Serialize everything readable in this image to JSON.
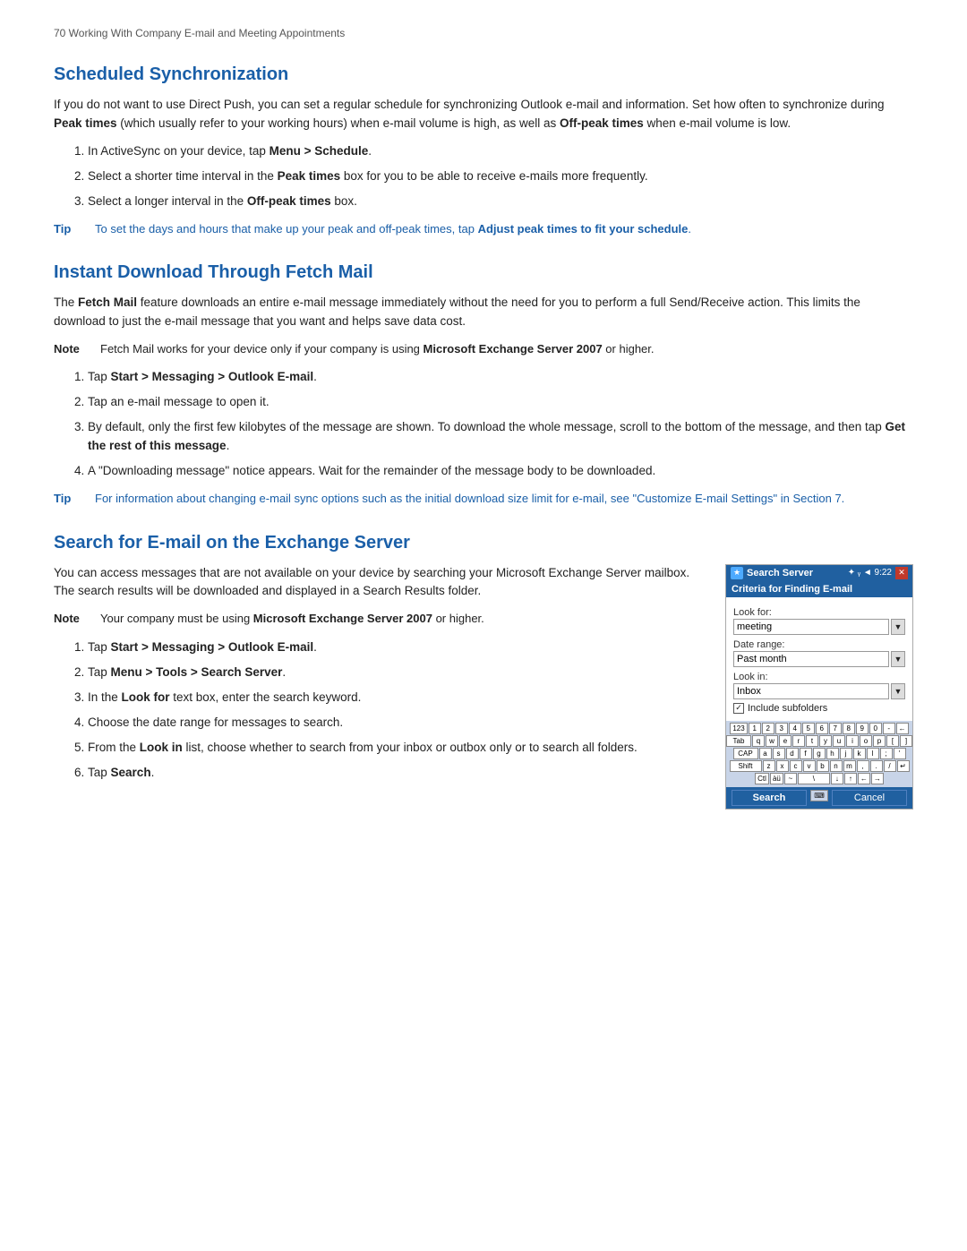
{
  "page": {
    "header": "70  Working With Company E-mail and Meeting Appointments",
    "sections": [
      {
        "id": "scheduled-sync",
        "title": "Scheduled Synchronization",
        "intro": "If you do not want to use Direct Push, you can set a regular schedule for synchronizing Outlook e-mail and information. Set how often to synchronize during ",
        "intro_bold1": "Peak times",
        "intro_mid1": " (which usually refer to your working hours) when e-mail volume is high, as well as ",
        "intro_bold2": "Off-peak times",
        "intro_mid2": " when e-mail volume is low.",
        "steps": [
          {
            "num": 1,
            "text": "In ActiveSync on your device, tap ",
            "bold": "Menu > Schedule",
            "end": "."
          },
          {
            "num": 2,
            "text": "Select a shorter time interval in the ",
            "bold": "Peak times",
            "end": " box for you to be able to receive e-mails more frequently."
          },
          {
            "num": 3,
            "text": "Select a longer interval in the ",
            "bold": "Off-peak times",
            "end": " box."
          }
        ],
        "tip": {
          "label": "Tip",
          "text": "To set the days and hours that make up your peak and off-peak times, tap ",
          "bold": "Adjust peak times to fit your schedule",
          "end": "."
        }
      },
      {
        "id": "fetch-mail",
        "title": "Instant Download Through Fetch Mail",
        "intro": "The ",
        "intro_bold": "Fetch Mail",
        "intro_rest": " feature downloads an entire e-mail message immediately without the need for you to perform a full Send/Receive action. This limits the download to just the e-mail message that you want and helps save data cost.",
        "note": {
          "label": "Note",
          "text": "Fetch Mail works for your device only if your company is using ",
          "bold": "Microsoft Exchange Server 2007",
          "end": " or higher."
        },
        "steps": [
          {
            "num": 1,
            "text": "Tap ",
            "bold": "Start > Messaging > Outlook E-mail",
            "end": "."
          },
          {
            "num": 2,
            "text": "Tap an e-mail message to open it.",
            "bold": "",
            "end": ""
          },
          {
            "num": 3,
            "text": "By default, only the first few kilobytes of the message are shown. To download the whole message, scroll to the bottom of the message, and then tap ",
            "bold": "Get the rest of this message",
            "end": "."
          },
          {
            "num": 4,
            "text": "A \"Downloading message\" notice appears. Wait for the remainder of the message body to be downloaded.",
            "bold": "",
            "end": ""
          }
        ],
        "tip": {
          "label": "Tip",
          "text": "For information about changing e-mail sync options such as the initial download size limit for e-mail, see \"Customize E-mail Settings\" in Section 7."
        }
      },
      {
        "id": "search-email",
        "title": "Search for E-mail on the Exchange Server",
        "intro": "You can access messages that are not available on your device by searching your Microsoft Exchange Server mailbox. The search results will be downloaded and displayed in a Search Results folder.",
        "note": {
          "label": "Note",
          "text": "Your company must be using ",
          "bold": "Microsoft Exchange Server 2007",
          "end": " or higher."
        },
        "steps": [
          {
            "num": 1,
            "text": "Tap ",
            "bold": "Start > Messaging > Outlook E-mail",
            "end": "."
          },
          {
            "num": 2,
            "text": "Tap ",
            "bold": "Menu > Tools > Search Server",
            "end": "."
          },
          {
            "num": 3,
            "text": "In the ",
            "bold": "Look for",
            "end": " text box, enter the search keyword."
          },
          {
            "num": 4,
            "text": "Choose the date range for messages to search.",
            "bold": "",
            "end": ""
          },
          {
            "num": 5,
            "text": "From the ",
            "bold": "Look in",
            "end": " list, choose whether to search from your inbox or outbox only or to search all folders."
          },
          {
            "num": 6,
            "text": "Tap ",
            "bold": "Search",
            "end": "."
          }
        ]
      }
    ],
    "phone_widget": {
      "titlebar": {
        "app_icon": "★",
        "title": "Search Server",
        "status": "✦ ᵧ₁ ◄ 9:22",
        "close": "✕"
      },
      "criteria_header": "Criteria for Finding E-mail",
      "fields": [
        {
          "label": "Look for:",
          "value": "meeting",
          "type": "dropdown"
        },
        {
          "label": "Date range:",
          "value": "Past month",
          "type": "dropdown"
        },
        {
          "label": "Look in:",
          "value": "Inbox",
          "type": "dropdown"
        }
      ],
      "checkbox": {
        "checked": true,
        "label": "Include subfolders"
      },
      "keyboard_rows": [
        [
          "123",
          "1",
          "2",
          "3",
          "4",
          "5",
          "6",
          "7",
          "8",
          "9",
          "0",
          "-",
          "←"
        ],
        [
          "Tab",
          "q",
          "w",
          "e",
          "r",
          "t",
          "y",
          "u",
          "i",
          "o",
          "p",
          "[",
          "]"
        ],
        [
          "CAP",
          "a",
          "s",
          "d",
          "f",
          "g",
          "h",
          "j",
          "k",
          "l",
          ";",
          "'"
        ],
        [
          "Shift",
          "z",
          "x",
          "c",
          "v",
          "b",
          "n",
          "m",
          ",",
          ".",
          "/",
          " ↵"
        ],
        [
          "Ctl",
          "àü",
          "~",
          "\\",
          "↓",
          "↑",
          "←",
          "→"
        ]
      ],
      "buttons": {
        "search": "Search",
        "cancel": "Cancel"
      }
    }
  }
}
